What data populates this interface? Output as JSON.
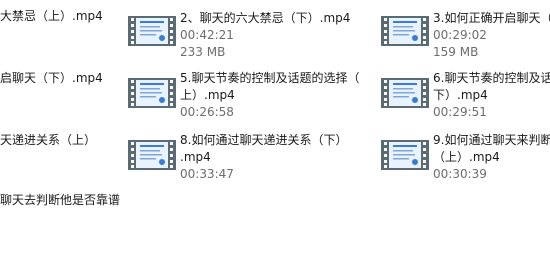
{
  "files": [
    {
      "name_lines": [
        "大禁忌（上）.mp4"
      ],
      "duration": "",
      "size": ""
    },
    {
      "name_lines": [
        "2、聊天的六大禁忌（下）.mp4"
      ],
      "duration": "00:42:21",
      "size": "233 MB"
    },
    {
      "name_lines": [
        "3.如何正确开启聊天（"
      ],
      "duration": "00:29:02",
      "size": "159 MB"
    },
    {
      "name_lines": [
        "启聊天（下）.mp4"
      ],
      "duration": "",
      "size": ""
    },
    {
      "name_lines": [
        "5.聊天节奏的控制及话题的选择（",
        "上）.mp4"
      ],
      "duration": "00:26:58",
      "size": ""
    },
    {
      "name_lines": [
        "6.聊天节奏的控制及话",
        "下）.mp4"
      ],
      "duration": "00:29:51",
      "size": ""
    },
    {
      "name_lines": [
        "天递进关系（上）"
      ],
      "duration": "",
      "size": ""
    },
    {
      "name_lines": [
        "8.如何通过聊天递进关系（下）",
        ".mp4"
      ],
      "duration": "00:33:47",
      "size": ""
    },
    {
      "name_lines": [
        "9.如何通过聊天来判断",
        "（上）.mp4"
      ],
      "duration": "00:30:39",
      "size": ""
    },
    {
      "name_lines": [
        "聊天去判断他是否靠谱"
      ],
      "duration": "",
      "size": ""
    }
  ],
  "icons": {
    "video_thumbnail": "video-thumbnail-icon"
  },
  "colors": {
    "filmstrip": "#5b6b74",
    "frame_bg": "#e9f3ff",
    "accent": "#3a7bd5",
    "secondary_text": "#6d6d6d"
  }
}
